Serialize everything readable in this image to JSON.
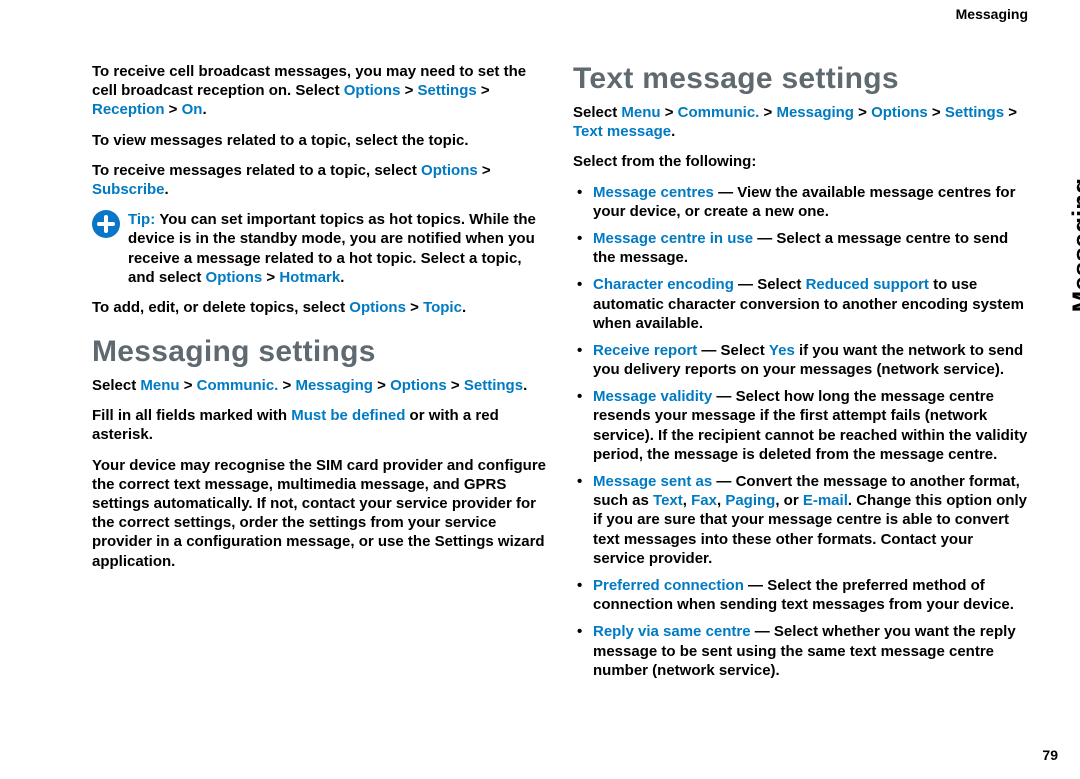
{
  "hdr": {
    "running_head": "Messaging",
    "side_tab": "Messaging",
    "page_no": "79"
  },
  "left": {
    "p1": {
      "a": "To receive cell broadcast messages, you may need to set the cell broadcast reception on. Select ",
      "s1": "Options",
      "g1": " > ",
      "s2": "Settings",
      "g2": " > ",
      "s3": "Reception",
      "g3": " > ",
      "s4": "On",
      "end": "."
    },
    "p2": "To view messages related to a topic, select the topic.",
    "p3": {
      "a": "To receive messages related to a topic, select ",
      "s1": "Options",
      "g1": " > ",
      "s2": "Subscribe",
      "end": "."
    },
    "tip": {
      "bold": "Tip: ",
      "a": "You can set important topics as hot topics. While the device is in the standby mode, you are notified when you receive a message related to a hot topic. Select a topic, and select ",
      "s1": "Options",
      "g1": " > ",
      "s2": "Hotmark",
      "end": "."
    },
    "p5": {
      "a": "To add, edit, or delete topics, select ",
      "s1": "Options",
      "g1": " > ",
      "s2": "Topic",
      "end": "."
    },
    "h1": "Messaging settings",
    "p6": {
      "a": "Select ",
      "s1": "Menu",
      "g1": " > ",
      "s2": "Communic.",
      "g2": " > ",
      "s3": "Messaging",
      "g3": " > ",
      "s4": "Options",
      "g4": " > ",
      "s5": "Settings",
      "end": "."
    },
    "p7": {
      "a": "Fill in all fields marked with ",
      "s1": "Must be defined",
      "b": " or with a red asterisk."
    },
    "p8": "Your device may recognise the SIM card provider and configure the correct text message, multimedia message, and GPRS settings automatically. If not, contact your service provider for the correct settings, order the settings from your service provider in a configuration message, or use the Settings wizard application."
  },
  "right": {
    "h1": "Text message settings",
    "p1": {
      "a": "Select ",
      "s1": "Menu",
      "g1": " > ",
      "s2": "Communic.",
      "g2": " > ",
      "s3": "Messaging",
      "g3": " > ",
      "s4": "Options",
      "g4": " > ",
      "s5": "Settings",
      "g5": " > ",
      "s6": "Text message",
      "end": "."
    },
    "p2": "Select from the following:",
    "items": [
      {
        "t": "Message centres",
        "a": " — View the available message centres for your device, or create a new one."
      },
      {
        "t": "Message centre in use",
        "a": " — Select a message centre to send the message."
      },
      {
        "t": "Character encoding",
        "a": " — Select ",
        "e1": "Reduced support",
        "b": " to use automatic character conversion to another encoding system when available."
      },
      {
        "t": "Receive report",
        "a": " — Select ",
        "e1": "Yes",
        "b": " if you want the network to send you delivery reports on your messages (network service)."
      },
      {
        "t": "Message validity",
        "a": " — Select how long the message centre resends your message if the first attempt fails (network service). If the recipient cannot be reached within the validity period, the message is deleted from the message centre."
      },
      {
        "t": "Message sent as",
        "a": " — Convert the message to another format, such as ",
        "e1": "Text",
        "c1": ", ",
        "e2": "Fax",
        "c2": ", ",
        "e3": "Paging",
        "c3": ", or ",
        "e4": "E-mail",
        "b": ". Change this option only if you are sure that your message centre is able to convert text messages into these other formats. Contact your service provider."
      },
      {
        "t": "Preferred connection ",
        "a": " — Select the preferred method of connection when sending text messages from your device."
      },
      {
        "t": "Reply via same centre",
        "a": " — Select whether you want the reply message to be sent using the same text message centre number (network service)."
      }
    ]
  }
}
